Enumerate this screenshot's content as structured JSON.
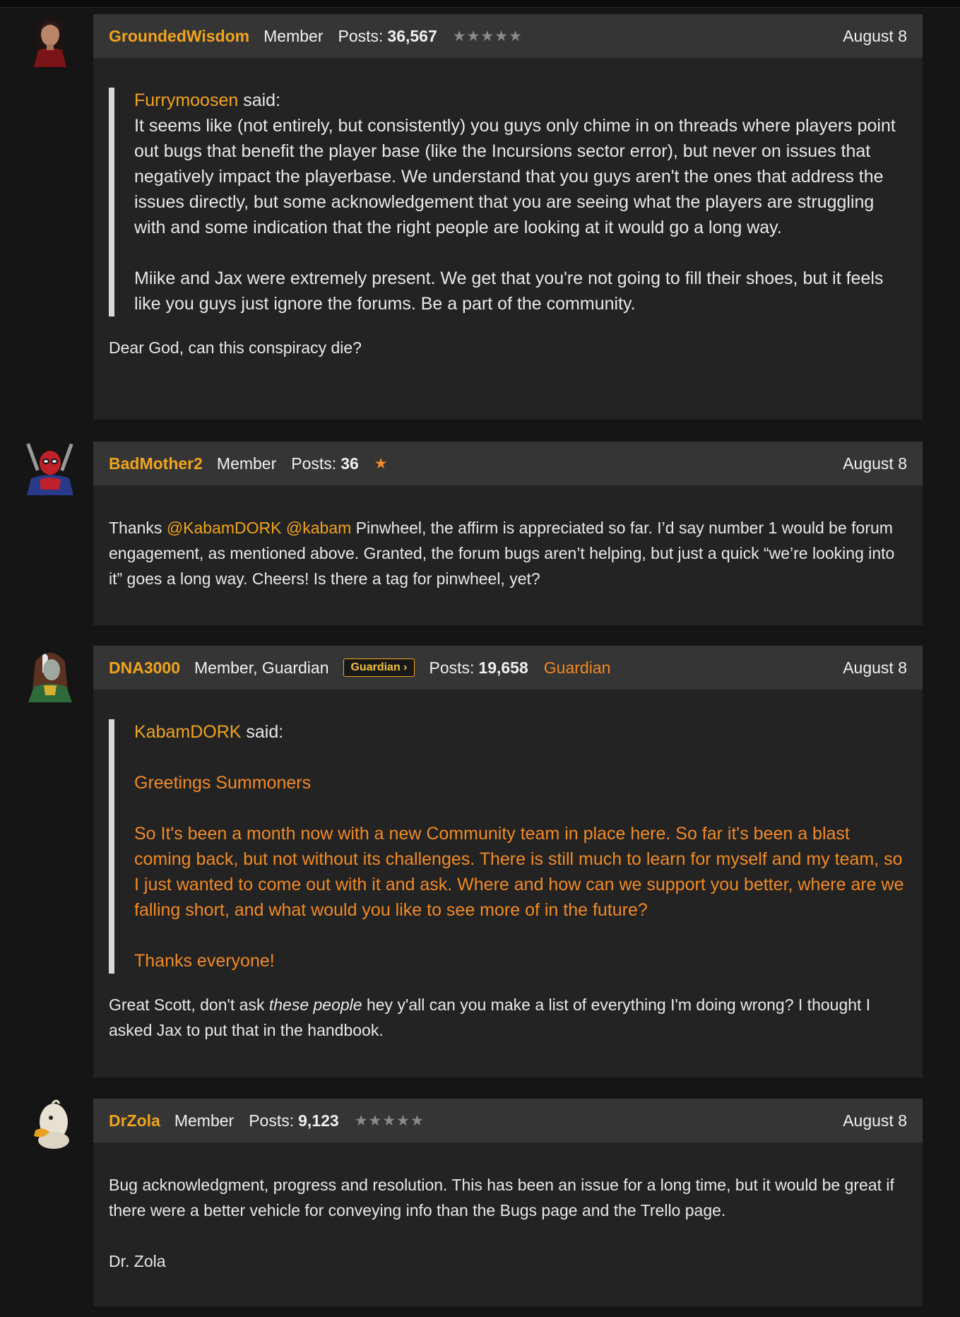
{
  "posts": [
    {
      "author": "GroundedWisdom",
      "role": "Member",
      "posts_label": "Posts:",
      "posts_count": "36,567",
      "stars": "★★★★★",
      "date": "August 8",
      "avatar": "avatar-grounded-wisdom",
      "quote": {
        "author": "Furrymoosen",
        "said": "said:",
        "paragraphs": [
          "It seems like (not entirely, but consistently) you guys only chime in on threads where players point out bugs that benefit the player base (like the Incursions sector error), but never on issues that negatively impact the playerbase. We understand that you guys aren't the ones that address the issues directly, but some acknowledgement that you are seeing what the players are struggling with and some indication that the right people are looking at it would go a long way.",
          "Miike and Jax were extremely present. We get that you're not going to fill their shoes, but it feels like you guys just ignore the forums. Be a part of the community."
        ]
      },
      "body": [
        "Dear God, can this conspiracy die?"
      ]
    },
    {
      "author": "BadMother2",
      "role": "Member",
      "posts_label": "Posts:",
      "posts_count": "36",
      "stars": "★",
      "date": "August 8",
      "avatar": "avatar-bad-mother2",
      "body_parts": {
        "pre": "Thanks ",
        "mention1": "@KabamDORK",
        "space": " ",
        "mention2": "@kabam",
        "post": " Pinwheel, the affirm is appreciated so far. I’d say number 1 would be forum engagement, as mentioned above. Granted, the forum bugs aren’t helping, but just a quick “we’re looking into it” goes a long way. Cheers! Is there a tag for pinwheel, yet?"
      }
    },
    {
      "author": "DNA3000",
      "role": "Member, Guardian",
      "badge": "Guardian ›",
      "posts_label": "Posts:",
      "posts_count": "19,658",
      "rank": "Guardian",
      "date": "August 8",
      "avatar": "avatar-dna3000",
      "quote": {
        "author": "KabamDORK",
        "said": "said:",
        "paragraphs": [
          "Greetings Summoners",
          "So It's been a month now with a new Community team in place here. So far it's been a blast coming back, but not without its challenges. There is still much to learn for myself and my team, so I just wanted to come out with it and ask. Where and how can we support you better, where are we falling short, and what would you like to see more of in the future?",
          "Thanks everyone!"
        ]
      },
      "body_parts": {
        "pre": "Great Scott, don't ask ",
        "em": "these people",
        "post": " hey y'all can you make a list of everything I'm doing wrong? I thought I asked Jax to put that in the handbook."
      }
    },
    {
      "author": "DrZola",
      "role": "Member",
      "posts_label": "Posts:",
      "posts_count": "9,123",
      "stars": "★★★★★",
      "date": "August 8",
      "avatar": "avatar-dr-zola",
      "body": [
        "Bug acknowledgment, progress and resolution. This has been an issue for a long time, but it would be great if there were a better vehicle for conveying info than the Bugs page and the Trello page.",
        "Dr. Zola"
      ]
    }
  ],
  "colors": {
    "background": "#151515",
    "card": "#232323",
    "header": "#353535",
    "author": "#f0a41c",
    "staff_quote": "#f08a24"
  }
}
